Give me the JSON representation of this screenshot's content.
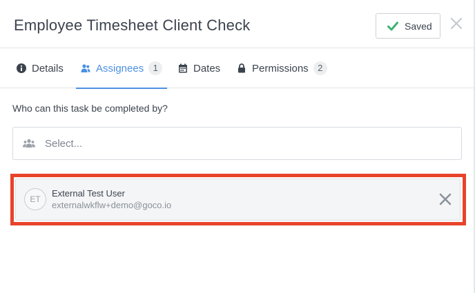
{
  "header": {
    "title": "Employee Timesheet Client Check",
    "saved_label": "Saved"
  },
  "tabs": [
    {
      "label": "Details",
      "icon": "info-circle-icon"
    },
    {
      "label": "Assignees",
      "icon": "users-icon",
      "count": "1",
      "active": true
    },
    {
      "label": "Dates",
      "icon": "calendar-icon"
    },
    {
      "label": "Permissions",
      "icon": "lock-icon",
      "count": "2"
    }
  ],
  "assignees_panel": {
    "question": "Who can this task be completed by?",
    "select_placeholder": "Select..."
  },
  "assignee": {
    "initials": "ET",
    "name": "External Test User",
    "email": "externalwkflw+demo@goco.io"
  },
  "colors": {
    "accent": "#4a90e2",
    "saved_check": "#3cb371",
    "highlight": "#e8432a"
  }
}
